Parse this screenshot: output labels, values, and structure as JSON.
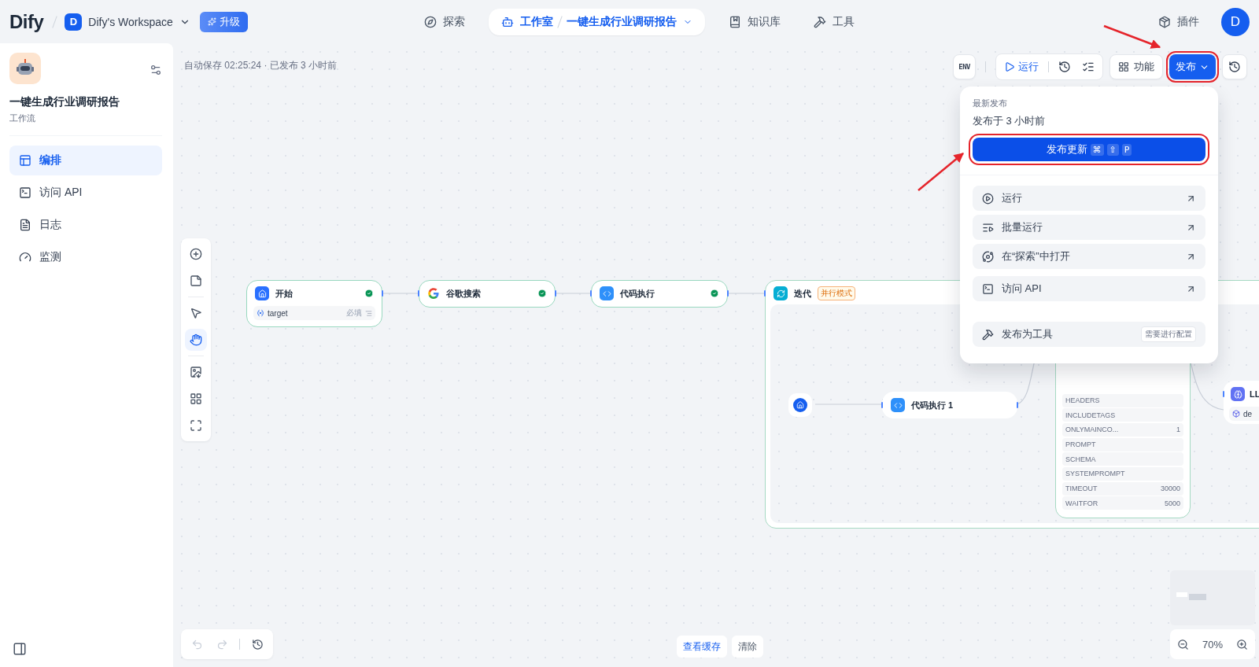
{
  "header": {
    "logo": "Dify",
    "workspace": {
      "initial": "D",
      "name": "Dify's Workspace"
    },
    "upgrade": "升级",
    "nav": [
      {
        "kind": "explore",
        "label": "探索",
        "selected": false
      },
      {
        "kind": "studio",
        "label": "工作室",
        "app": "一键生成行业调研报告",
        "selected": true
      },
      {
        "kind": "datasets",
        "label": "知识库",
        "selected": false
      },
      {
        "kind": "tools",
        "label": "工具",
        "selected": false
      }
    ],
    "plugins": "插件",
    "avatar": "D"
  },
  "sidebar": {
    "app_name": "一键生成行业调研报告",
    "app_type": "工作流",
    "items": [
      {
        "kind": "orchestrate",
        "label": "编排",
        "selected": true
      },
      {
        "kind": "api",
        "label": "访问 API",
        "selected": false
      },
      {
        "kind": "logs",
        "label": "日志",
        "selected": false
      },
      {
        "kind": "monitor",
        "label": "监测",
        "selected": false
      }
    ]
  },
  "canvas": {
    "autosave": "自动保存 02:25:24 · 已发布 3 小时前",
    "toolbar": {
      "env": "ENV",
      "run": "运行",
      "features": "功能",
      "publish": {
        "label": "发布",
        "highlighted": true
      }
    },
    "publish_menu": {
      "heading": "最新发布",
      "published": "发布于 3 小时前",
      "update": {
        "label": "发布更新",
        "keys": [
          "⌘",
          "⇧",
          "P"
        ],
        "highlighted": true
      },
      "items": [
        {
          "kind": "play",
          "label": "运行"
        },
        {
          "kind": "batch",
          "label": "批量运行"
        },
        {
          "kind": "explore",
          "label": "在“探索”中打开"
        },
        {
          "kind": "api",
          "label": "访问 API"
        }
      ],
      "tool": {
        "label": "发布为工具",
        "badge": "需要进行配置"
      }
    },
    "tools": [
      {
        "kind": "add",
        "selected": false
      },
      {
        "kind": "note",
        "selected": false
      },
      {
        "kind": "pointer",
        "selected": false
      },
      {
        "kind": "hand",
        "selected": true
      },
      {
        "kind": "export",
        "selected": false
      },
      {
        "kind": "organize",
        "selected": false
      },
      {
        "kind": "fullscreen",
        "selected": false
      }
    ],
    "nodes": [
      {
        "kind": "start",
        "title": "开始",
        "success": true,
        "variables": [
          {
            "name": "target",
            "required": "必填"
          }
        ]
      },
      {
        "kind": "google",
        "title": "谷歌搜索",
        "success": true
      },
      {
        "kind": "code",
        "title": "代码执行",
        "success": true
      },
      {
        "kind": "iteration",
        "title": "迭代",
        "badge": "并行模式",
        "children": [
          {
            "kind": "iteration_start"
          },
          {
            "kind": "code",
            "title": "代码执行 1"
          },
          {
            "kind": "params",
            "rows": [
              {
                "name": "HEADERS"
              },
              {
                "name": "INCLUDETAGS"
              },
              {
                "name": "ONLYMAINCO...",
                "value": "1"
              },
              {
                "name": "PROMPT"
              },
              {
                "name": "SCHEMA"
              },
              {
                "name": "SYSTEMPROMPT"
              },
              {
                "name": "TIMEOUT",
                "value": "30000"
              },
              {
                "name": "WAITFOR",
                "value": "5000"
              }
            ]
          },
          {
            "kind": "llm",
            "title": "LL",
            "model": "de"
          }
        ]
      }
    ]
  },
  "footer": {
    "history": [
      {
        "kind": "undo",
        "disabled": true
      },
      {
        "kind": "redo",
        "disabled": true
      },
      {
        "kind": "versions",
        "disabled": false
      }
    ],
    "cache": "查看缓存",
    "clear": "清除",
    "zoom": "70%"
  }
}
